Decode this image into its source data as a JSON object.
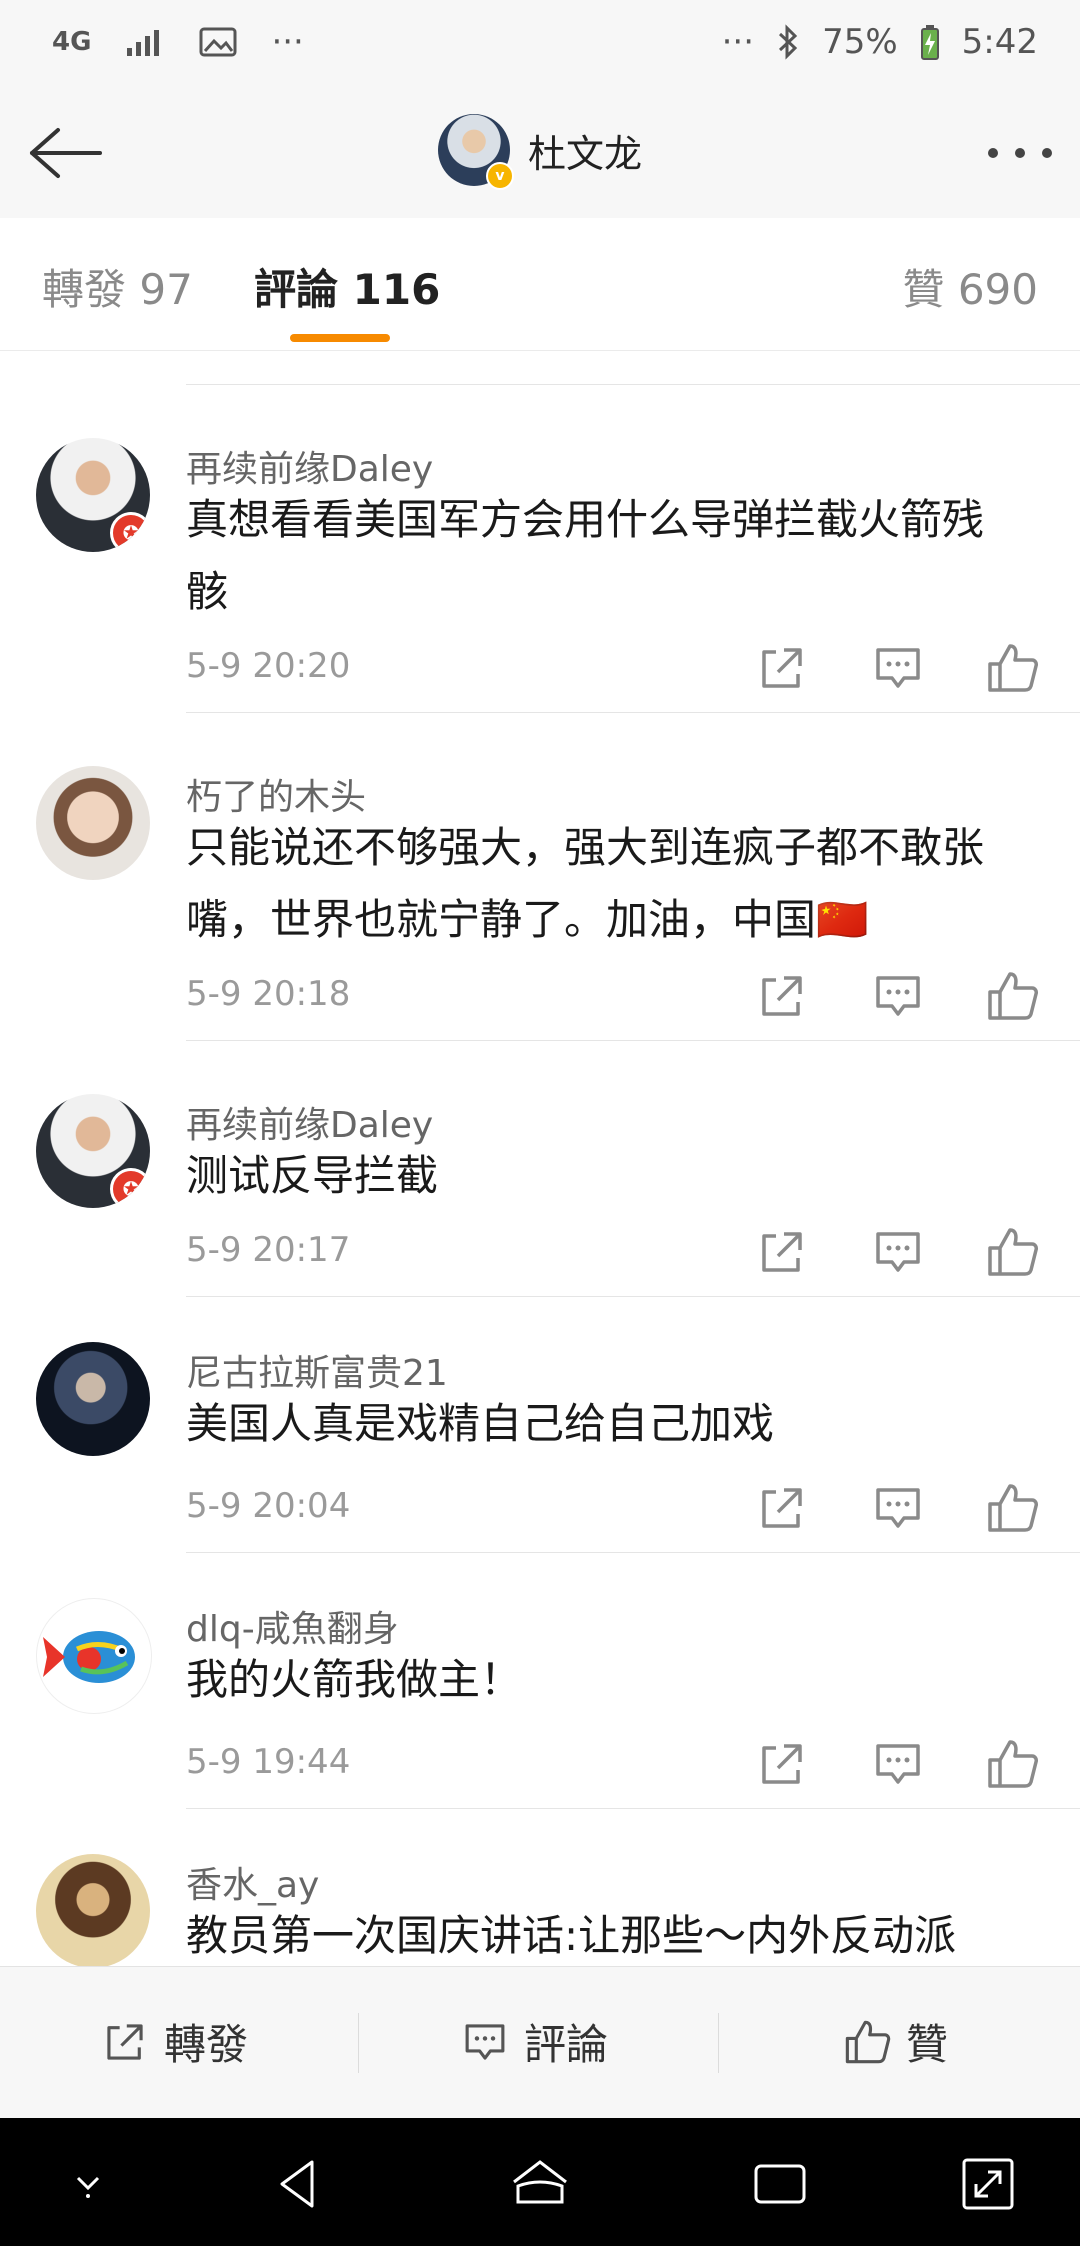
{
  "status_bar": {
    "network": "4G",
    "dots_left": "···",
    "dots_right": "···",
    "battery": "75%",
    "time": "5:42"
  },
  "header": {
    "title": "杜文龙"
  },
  "tabs": [
    {
      "label": "轉發 97",
      "active": false
    },
    {
      "label": "評論 116",
      "active": true
    },
    {
      "label": "贊 690",
      "active": false
    }
  ],
  "accent_color": "#f78a00",
  "comments": [
    {
      "user": "再续前缘Daley",
      "text_line1": "真想看看美国军方会用什么导弹拦截火箭残",
      "text_line2": "骸",
      "time": "5-9 20:20"
    },
    {
      "user": "朽了的木头",
      "text_line1": "只能说还不够强大，强大到连疯子都不敢张",
      "text_line2": "嘴，世界也就宁静了。加油，中国🇨🇳",
      "time": "5-9 20:18"
    },
    {
      "user": "再续前缘Daley",
      "text_line1": "测试反导拦截",
      "time": "5-9 20:17"
    },
    {
      "user": "尼古拉斯富贵21",
      "text_line1": "美国人真是戏精自己给自己加戏",
      "time": "5-9 20:04"
    },
    {
      "user": "dlq-咸魚翻身",
      "text_line1": "我的火箭我做主！",
      "time": "5-9 19:44"
    },
    {
      "user": "香水_ay",
      "text_line1": "教员第一次国庆讲话:让那些～内外反动派"
    }
  ],
  "bottom_bar": {
    "repost": "轉發",
    "comment": "評論",
    "like": "贊"
  }
}
